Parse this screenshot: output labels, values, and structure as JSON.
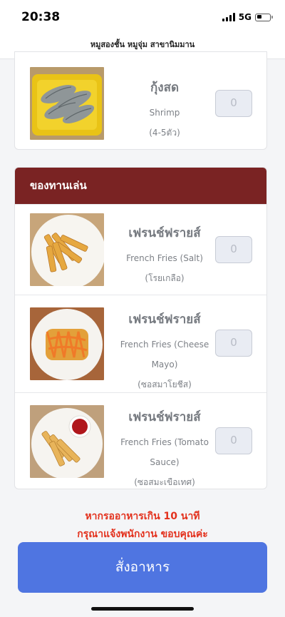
{
  "status_bar": {
    "time": "20:38",
    "network": "5G"
  },
  "header": {
    "title": "หมูสองชั้น หมูจุ่ม สาขานิมมาน"
  },
  "top_item": {
    "name_th": "กุ้งสด",
    "name_en": "Shrimp",
    "note": "(4-5ตัว)",
    "quantity_placeholder": "0"
  },
  "section": {
    "title": "ของทานเล่น",
    "items": [
      {
        "name_th": "เฟรนช์ฟรายส์",
        "name_en_lines": [
          "French Fries (Salt)"
        ],
        "note": "(โรยเกลือ)",
        "quantity_placeholder": "0"
      },
      {
        "name_th": "เฟรนช์ฟรายส์",
        "name_en_lines": [
          "French Fries (Cheese",
          "Mayo)"
        ],
        "note": "(ซอสมาโยชีส)",
        "quantity_placeholder": "0"
      },
      {
        "name_th": "เฟรนช์ฟรายส์",
        "name_en_lines": [
          "French Fries (Tomato",
          "Sauce)"
        ],
        "note": "(ซอสมะเขือเทศ)",
        "quantity_placeholder": "0"
      }
    ]
  },
  "notice": {
    "line1": "หากรออาหารเกิน 10 นาที",
    "line2": "กรุณาแจ้งพนักงาน ขอบคุณค่ะ"
  },
  "order_button": {
    "label": "สั่งอาหาร",
    "color": "#4f75e1"
  },
  "colors": {
    "section_header": "#7a2323",
    "notice": "#e3311d"
  }
}
